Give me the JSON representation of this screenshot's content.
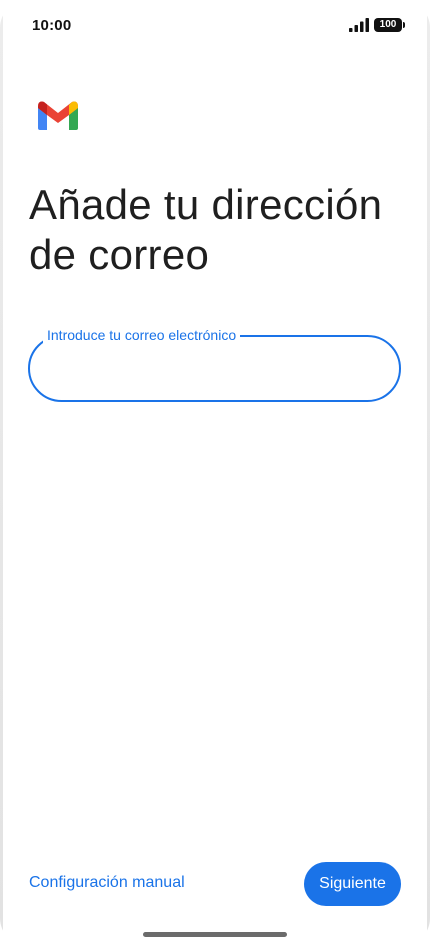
{
  "status_bar": {
    "time": "10:00",
    "signal_icon": "signal-bars-icon",
    "battery_level": "100"
  },
  "logo": {
    "icon": "gmail-logo",
    "colors": {
      "blue": "#4285F4",
      "red": "#EA4335",
      "yellow": "#FBBC04",
      "green": "#34A853"
    }
  },
  "header": {
    "title": "Añade tu dirección de correo"
  },
  "email_field": {
    "label": "Introduce tu correo electrónico",
    "value": "",
    "accent": "#1a73e8"
  },
  "actions": {
    "manual_config_label": "Configuración manual",
    "next_label": "Siguiente"
  }
}
